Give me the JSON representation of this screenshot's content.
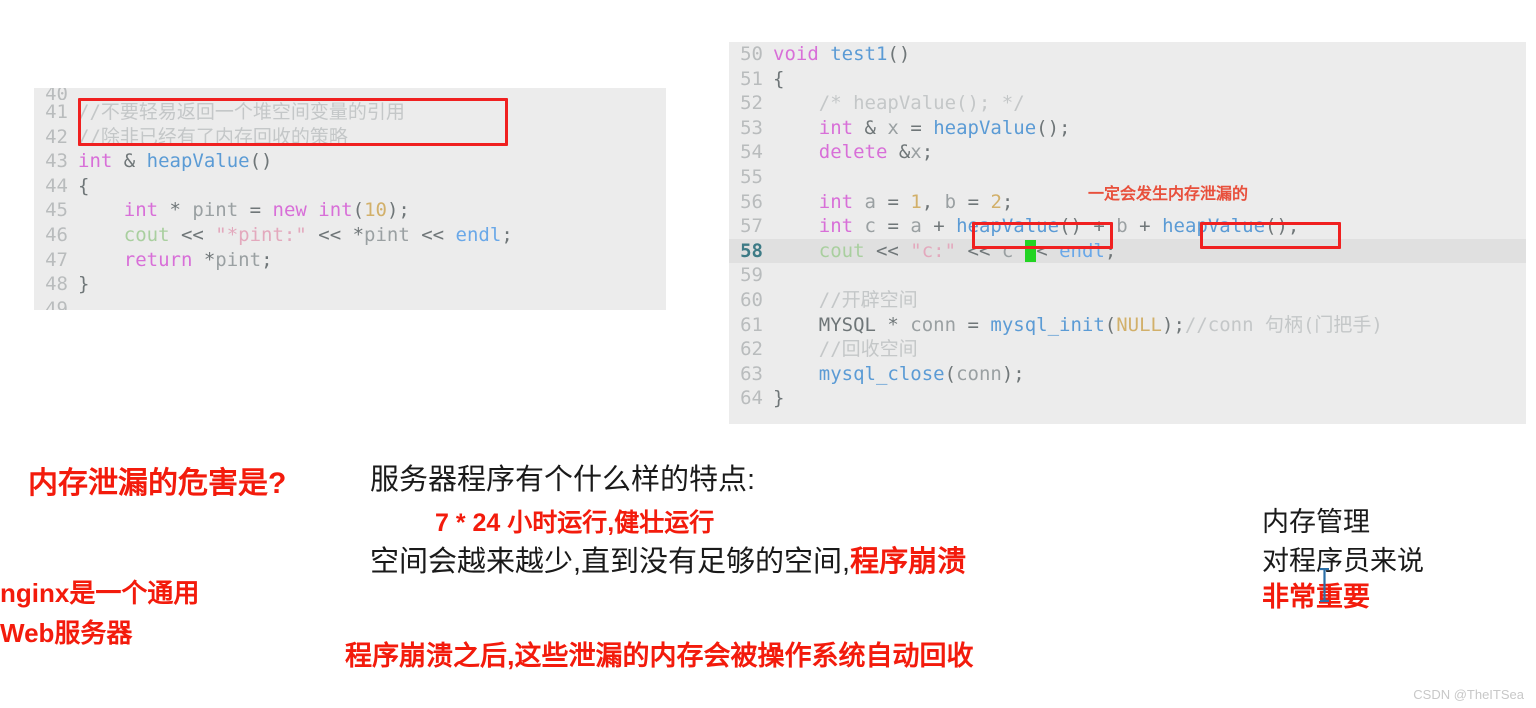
{
  "slide": {
    "watermark": "CSDN @TheITSea"
  },
  "code_left": {
    "name": "heapValue-function-snippet",
    "lines": [
      {
        "number": "40",
        "partial_top": true,
        "text": ""
      },
      {
        "number": "41",
        "text": "//不要轻易返回一个堆空间变量的引用"
      },
      {
        "number": "42",
        "text": "//除非已经有了内存回收的策略"
      },
      {
        "number": "43",
        "text": "int & heapValue()"
      },
      {
        "number": "44",
        "text": "{"
      },
      {
        "number": "45",
        "text": "    int * pint = new int(10);"
      },
      {
        "number": "46",
        "text": "    cout << \"*pint:\" << *pint << endl;"
      },
      {
        "number": "47",
        "text": "    return *pint;"
      },
      {
        "number": "48",
        "text": "}"
      },
      {
        "number": "49",
        "text": ""
      }
    ],
    "annotation_box_label": "comment-warning-box"
  },
  "code_right": {
    "name": "test1-function-snippet",
    "lines": [
      {
        "number": "50",
        "text": "void test1()"
      },
      {
        "number": "51",
        "text": "{"
      },
      {
        "number": "52",
        "text": "    /* heapValue(); */"
      },
      {
        "number": "53",
        "text": "    int & x = heapValue();"
      },
      {
        "number": "54",
        "text": "    delete &x;"
      },
      {
        "number": "55",
        "text": ""
      },
      {
        "number": "56",
        "text": "    int a = 1, b = 2;"
      },
      {
        "number": "57",
        "text": "    int c = a + heapValue() + b + heapValue();"
      },
      {
        "number": "58",
        "text": "    cout << \"c:\" << c << endl;",
        "active": true
      },
      {
        "number": "59",
        "text": ""
      },
      {
        "number": "60",
        "text": "    //开辟空间"
      },
      {
        "number": "61",
        "text": "    MYSQL * conn = mysql_init(NULL);//conn 句柄(门把手)"
      },
      {
        "number": "62",
        "text": "    //回收空间"
      },
      {
        "number": "63",
        "text": "    mysql_close(conn);"
      },
      {
        "number": "64",
        "text": "}"
      }
    ],
    "annotation": "一定会发生内存泄漏的",
    "highlight_token": "<"
  },
  "notes": {
    "heading_harm": "内存泄漏的危害是?",
    "nginx_line1": "nginx是一个通用",
    "nginx_line2": "Web服务器",
    "server_question": "服务器程序有个什么样的特点:",
    "server_247": "7 * 24 小时运行,健壮运行",
    "server_shrink_plain": "空间会越来越少,直到没有足够的空间,",
    "server_shrink_red": "程序崩溃",
    "crash_recycle": "程序崩溃之后,这些泄漏的内存会被操作系统自动回收",
    "memory_mgmt_line1": "内存管理",
    "memory_mgmt_line2": "对程序员来说",
    "memory_mgmt_line3": "非常重要"
  },
  "colors": {
    "accent_red": "#f31b0c",
    "annotation_red": "#e8503c",
    "box_red": "#f02020",
    "cursor_green": "#23d423",
    "panel_bg": "#ececec",
    "active_line_bg": "#e0e0e0"
  }
}
